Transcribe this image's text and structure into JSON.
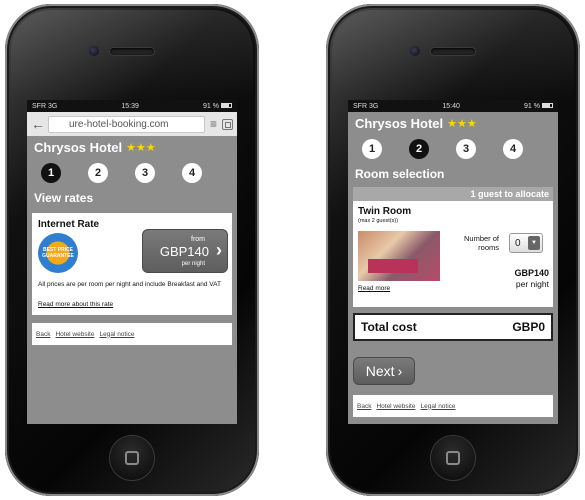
{
  "left": {
    "status": {
      "carrier": "SFR 3G",
      "time": "15:39",
      "battery": "91 %"
    },
    "url": "ure-hotel-booking.com",
    "hotel_name": "Chrysos Hotel",
    "stars": "★★★",
    "steps": [
      "1",
      "2",
      "3",
      "4"
    ],
    "active_step": 0,
    "section_title": "View rates",
    "rate": {
      "title": "Internet Rate",
      "badge_text": "BEST PRICE GUARANTEE",
      "from": "from",
      "price": "GBP140",
      "per": "per night",
      "note": "All prices are per room per night and include Breakfast and VAT",
      "link": "Read more about this rate"
    },
    "footer": [
      "Back",
      "Hotel website",
      "Legal notice"
    ]
  },
  "right": {
    "status": {
      "carrier": "SFR 3G",
      "time": "15:40",
      "battery": "91 %"
    },
    "hotel_name": "Chrysos Hotel",
    "stars": "★★★",
    "steps": [
      "1",
      "2",
      "3",
      "4"
    ],
    "active_step": 1,
    "section_title": "Room selection",
    "guests_note": "1 guest to allocate",
    "room": {
      "name": "Twin Room",
      "capacity": "(max 2 guest(s))",
      "rooms_label_1": "Number of",
      "rooms_label_2": "rooms",
      "rooms_value": "0",
      "price": "GBP140",
      "per": "per night",
      "link": "Read more"
    },
    "total": {
      "label": "Total cost",
      "value": "GBP0"
    },
    "next_label": "Next",
    "footer": [
      "Back",
      "Hotel website",
      "Legal notice"
    ]
  }
}
